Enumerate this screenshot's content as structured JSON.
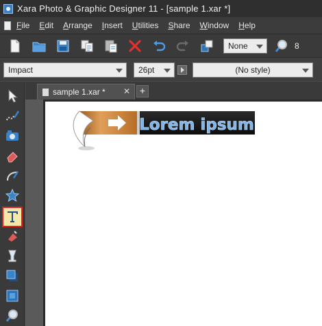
{
  "window": {
    "title": "Xara Photo & Graphic Designer 11 - [sample 1.xar *]"
  },
  "menu": [
    {
      "label": "File",
      "ul": "F",
      "rest": "ile"
    },
    {
      "label": "Edit",
      "ul": "E",
      "rest": "dit"
    },
    {
      "label": "Arrange",
      "ul": "A",
      "rest": "rrange"
    },
    {
      "label": "Insert",
      "ul": "I",
      "rest": "nsert"
    },
    {
      "label": "Utilities",
      "ul": "U",
      "rest": "tilities"
    },
    {
      "label": "Share",
      "ul": "S",
      "rest": "hare"
    },
    {
      "label": "Window",
      "ul": "W",
      "rest": "indow"
    },
    {
      "label": "Help",
      "ul": "H",
      "rest": "elp"
    }
  ],
  "toolbar": {
    "icons": [
      "new-document-icon",
      "open-folder-icon",
      "save-icon",
      "copy-icon",
      "paste-icon",
      "delete-icon",
      "undo-icon",
      "redo-icon",
      "arrange-icon"
    ],
    "zoom_select": "None",
    "trailing_value": "8"
  },
  "textbar": {
    "font": "Impact",
    "size": "26pt",
    "style": "(No style)"
  },
  "toolbox": {
    "tools": [
      "selector-tool-icon",
      "freehand-tool-icon",
      "photo-tool-icon",
      "eraser-tool-icon",
      "shape-editor-tool-icon",
      "star-tool-icon",
      "text-tool-icon",
      "fill-tool-icon",
      "transparency-tool-icon",
      "shadow-tool-icon",
      "bevel-tool-icon",
      "zoom-tool-icon"
    ],
    "active": "text-tool-icon"
  },
  "tabs": [
    {
      "label": "sample 1.xar *"
    }
  ],
  "canvas": {
    "banner_text": "Lorem ipsum"
  },
  "colors": {
    "accent_red": "#e02020",
    "banner_orange": "#c9782c",
    "banner_text": "#7fb4ea"
  }
}
